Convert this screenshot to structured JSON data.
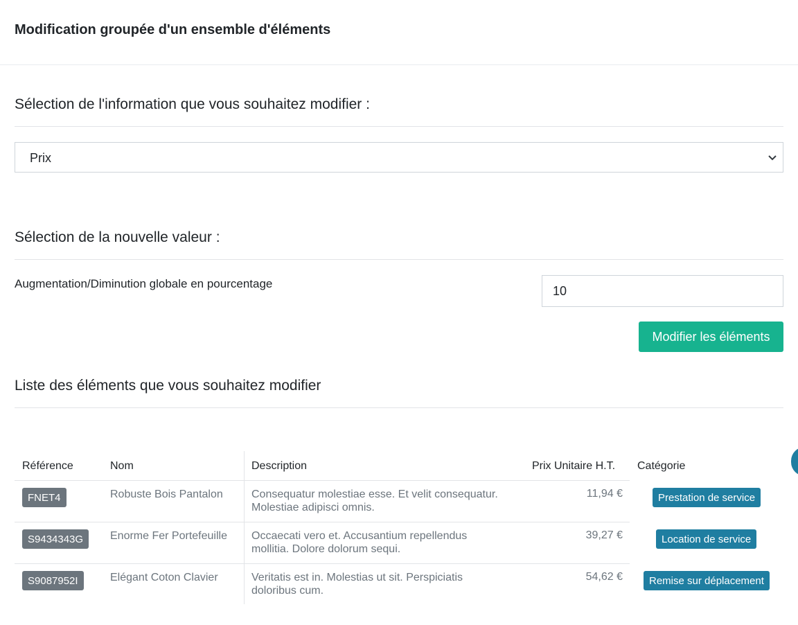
{
  "header": {
    "title": "Modification groupée d'un ensemble d'éléments"
  },
  "section_info": {
    "title": "Sélection de l'information que vous souhaitez modifier :"
  },
  "info_select": {
    "selected": "Prix"
  },
  "section_value": {
    "title": "Sélection de la nouvelle valeur :"
  },
  "percent_field": {
    "label": "Augmentation/Diminution globale en pourcentage",
    "value": "10"
  },
  "submit": {
    "label": "Modifier les éléments"
  },
  "section_list": {
    "title": "Liste des éléments que vous souhaitez modifier"
  },
  "table": {
    "headers": {
      "reference": "Référence",
      "name": "Nom",
      "description": "Description",
      "price": "Prix Unitaire H.T.",
      "category": "Catégorie"
    },
    "rows": [
      {
        "reference": "FNET4",
        "name": "Robuste Bois Pantalon",
        "description_line1": "Consequatur molestiae esse. Et velit consequatur.",
        "description_line2": "Molestiae adipisci omnis.",
        "price": "11,94 €",
        "category": "Prestation de service"
      },
      {
        "reference": "S9434343G",
        "name": "Enorme Fer Portefeuille",
        "description_line1": "Occaecati vero et. Accusantium repellendus",
        "description_line2": "mollitia. Dolore dolorum sequi.",
        "price": "39,27 €",
        "category": "Location de service"
      },
      {
        "reference": "S9087952I",
        "name": "Elégant Coton Clavier",
        "description_line1": "Veritatis est in. Molestias ut sit. Perspiciatis",
        "description_line2": "doloribus cum.",
        "price": "54,62 €",
        "category": "Remise sur déplacement"
      }
    ]
  },
  "colors": {
    "primary": "#17b38f",
    "badge_secondary": "#6c757d",
    "badge_info": "#1f7ea1"
  }
}
